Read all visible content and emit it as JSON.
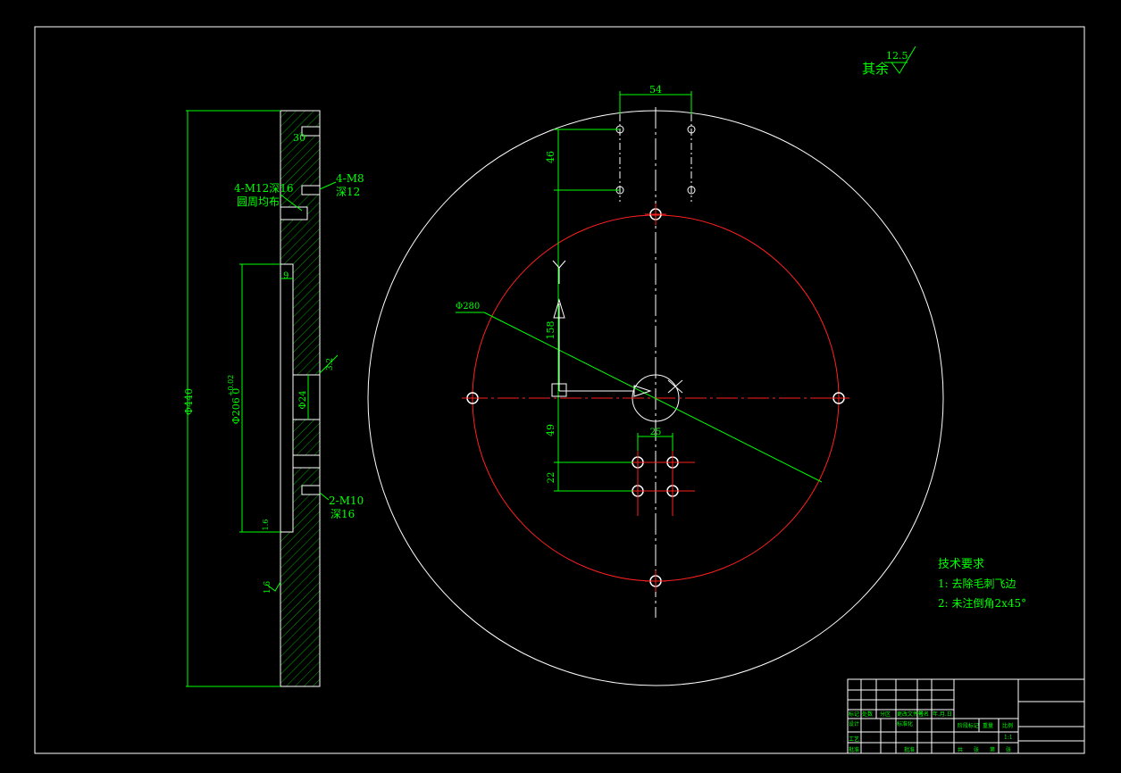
{
  "colors": {
    "background": "#000000",
    "frame": "#ffffff",
    "dimension": "#00ff00",
    "hole_circle": "#ff2020",
    "outline": "#ffffff",
    "hatch": "#00ff00"
  },
  "surface_finish": {
    "label": "其余",
    "value": "12.5"
  },
  "side_view": {
    "thread_left": "4-M12深16",
    "thread_left_note": "圆周均布",
    "thread_right": "4-M8",
    "thread_right_depth": "深12",
    "thread_bottom": "2-M10",
    "thread_bottom_depth": "深16",
    "dim_width": "30",
    "dim_recess": "9",
    "dim_outer_dia": "Φ440",
    "dim_recess_dia": "Φ206 0",
    "dim_recess_tol": "+0.02",
    "dim_bore": "Φ24",
    "roughness_a": "3.2",
    "roughness_b": "1.6",
    "roughness_c": "1.6"
  },
  "front_view": {
    "dim_top_spacing": "54",
    "dim_top_height": "46",
    "dim_pcd": "Φ280",
    "dim_vertical": "158",
    "dim_lower": "49",
    "dim_small_spacing": "25",
    "dim_small_height": "22",
    "axis_y": "Y"
  },
  "tech_requirements": {
    "title": "技术要求",
    "items": [
      "1: 去除毛刺飞边",
      "2: 未注倒角2x45°"
    ]
  },
  "title_block": {
    "header_cells": [
      "标记",
      "处数",
      "分区",
      "更改文件号",
      "签名",
      "年.月.日"
    ],
    "row_design": "设计",
    "row_standard": "标准化",
    "row_stage": "阶段标记",
    "row_weight": "重量",
    "row_scale": "比例",
    "scale_value": "1:1",
    "row_process": "工艺",
    "row_approve": "批准",
    "row_sheet": [
      "共",
      "张",
      "第",
      "张"
    ]
  }
}
